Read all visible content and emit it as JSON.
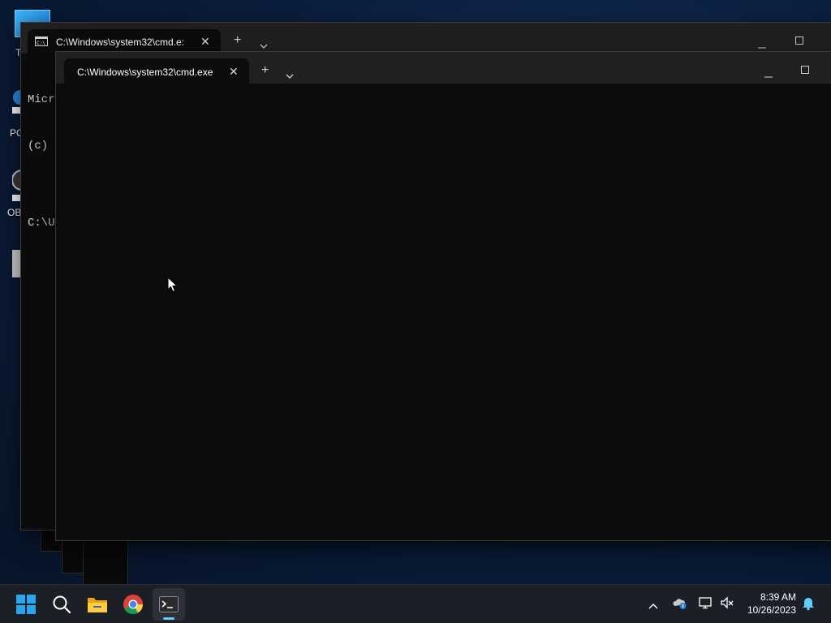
{
  "desktop": {
    "icons": [
      {
        "label": "T"
      },
      {
        "label": "PC"
      },
      {
        "label": "OB"
      }
    ]
  },
  "windows": {
    "back": {
      "tab_title": "C:\\Windows\\system32\\cmd.e:",
      "console_lines": [
        "Micr",
        "(c)",
        "",
        "C:\\U"
      ]
    },
    "front": {
      "tab_title": "C:\\Windows\\system32\\cmd.exe"
    }
  },
  "taskbar": {
    "apps": [
      "start",
      "search",
      "file-explorer",
      "chrome",
      "terminal"
    ],
    "active_app": "terminal",
    "clock": {
      "time": "8:39 AM",
      "date": "10/26/2023"
    }
  },
  "colors": {
    "terminal_bg": "#0c0c0c",
    "titlebar_bg": "#202020",
    "taskbar_bg": "#1c1f26",
    "accent": "#60cdff"
  }
}
